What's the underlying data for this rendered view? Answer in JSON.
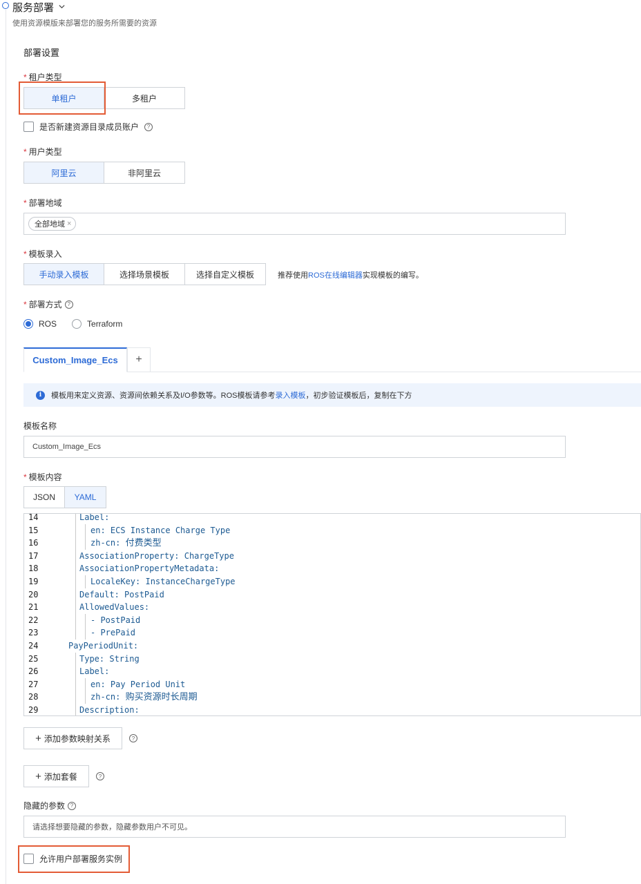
{
  "section": {
    "title": "服务部署",
    "subtitle": "使用资源模版来部署您的服务所需要的资源",
    "group_title": "部署设置"
  },
  "tenant_type": {
    "label": "租户类型",
    "options": [
      "单租户",
      "多租户"
    ],
    "selected": "单租户"
  },
  "new_member_account": {
    "label": "是否新建资源目录成员账户",
    "checked": false
  },
  "user_type": {
    "label": "用户类型",
    "options": [
      "阿里云",
      "非阿里云"
    ],
    "selected": "阿里云"
  },
  "region": {
    "label": "部署地域",
    "tag": "全部地域"
  },
  "template_input": {
    "label": "模板录入",
    "options": [
      "手动录入模板",
      "选择场景模板",
      "选择自定义模板"
    ],
    "selected": "手动录入模板",
    "hint_pre": "推荐使用",
    "hint_link": "ROS在线编辑器",
    "hint_post": "实现模板的编写。"
  },
  "deploy_method": {
    "label": "部署方式",
    "options": [
      "ROS",
      "Terraform"
    ],
    "selected": "ROS"
  },
  "template_tab": {
    "name": "Custom_Image_Ecs",
    "add": "+"
  },
  "info": {
    "text_pre": "模板用来定义资源、资源间依赖关系及I/O参数等。ROS模板请参考",
    "link": "录入模板",
    "text_post": "，初步验证模板后，复制在下方"
  },
  "template_name": {
    "label": "模板名称",
    "value": "Custom_Image_Ecs"
  },
  "template_content": {
    "label": "模板内容",
    "formats": [
      "JSON",
      "YAML"
    ],
    "selected": "YAML"
  },
  "code_lines": [
    {
      "n": "14",
      "k": "Label:",
      "v": ""
    },
    {
      "n": "15",
      "k": "en: ",
      "v": "ECS Instance Charge Type"
    },
    {
      "n": "16",
      "k": "zh-cn: ",
      "v": "付费类型"
    },
    {
      "n": "17",
      "k": "AssociationProperty: ",
      "v": "ChargeType"
    },
    {
      "n": "18",
      "k": "AssociationPropertyMetadata:",
      "v": ""
    },
    {
      "n": "19",
      "k": "LocaleKey: ",
      "v": "InstanceChargeType"
    },
    {
      "n": "20",
      "k": "Default: ",
      "v": "PostPaid"
    },
    {
      "n": "21",
      "k": "AllowedValues:",
      "v": ""
    },
    {
      "n": "22",
      "k": "- ",
      "v": "PostPaid"
    },
    {
      "n": "23",
      "k": "- ",
      "v": "PrePaid"
    },
    {
      "n": "24",
      "k": "PayPeriodUnit:",
      "v": ""
    },
    {
      "n": "25",
      "k": "Type: ",
      "v": "String"
    },
    {
      "n": "26",
      "k": "Label:",
      "v": ""
    },
    {
      "n": "27",
      "k": "en: ",
      "v": "Pay Period Unit"
    },
    {
      "n": "28",
      "k": "zh-cn: ",
      "v": "购买资源时长周期"
    },
    {
      "n": "29",
      "k": "Description:",
      "v": ""
    }
  ],
  "buttons": {
    "add_param_mapping": "添加参数映射关系",
    "add_package": "添加套餐"
  },
  "hidden_params": {
    "label": "隐藏的参数",
    "placeholder": "请选择想要隐藏的参数，隐藏参数用户不可见。"
  },
  "allow_user_deploy": {
    "label": "允许用户部署服务实例",
    "checked": false
  }
}
